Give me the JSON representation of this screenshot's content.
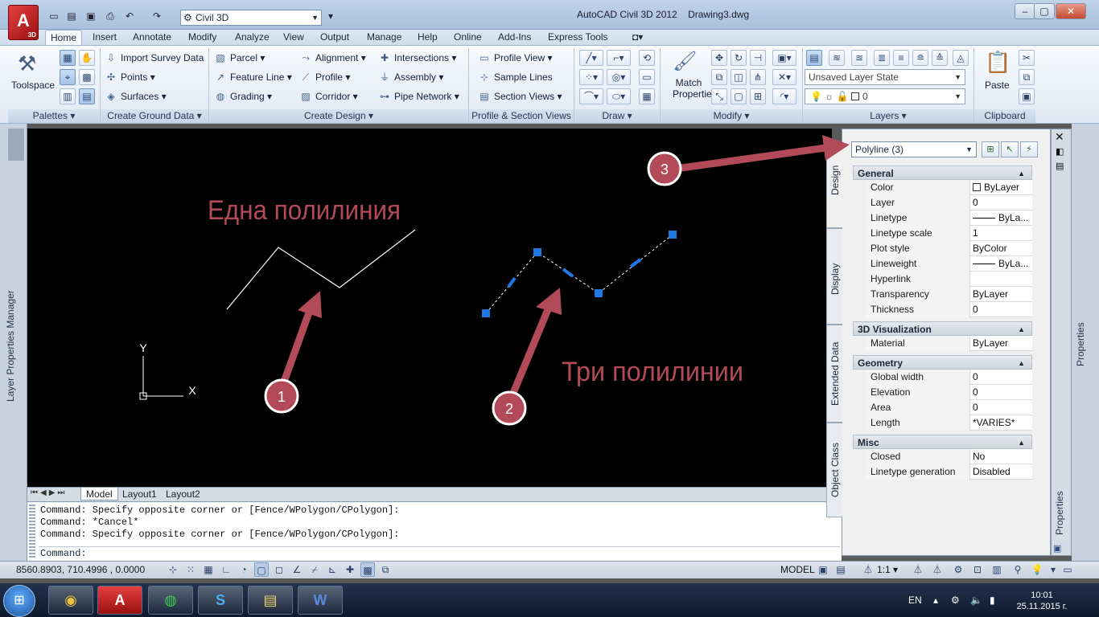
{
  "window": {
    "title": "AutoCAD Civil 3D 2012",
    "document": "Drawing3.dwg",
    "workspace": "Civil 3D",
    "logo_sub": "3D"
  },
  "tabs": [
    "Home",
    "Insert",
    "Annotate",
    "Modify",
    "Analyze",
    "View",
    "Output",
    "Manage",
    "Help",
    "Online",
    "Add-Ins",
    "Express Tools"
  ],
  "ribbon": {
    "toolspace": "Toolspace",
    "ground": {
      "import": "Import Survey Data",
      "points": "Points",
      "surfaces": "Surfaces"
    },
    "design": {
      "parcel": "Parcel",
      "feature_line": "Feature Line",
      "grading": "Grading",
      "alignment": "Alignment",
      "profile": "Profile",
      "corridor": "Corridor",
      "intersections": "Intersections",
      "assembly": "Assembly",
      "pipe_network": "Pipe Network"
    },
    "profile": {
      "profile_view": "Profile View",
      "sample_lines": "Sample Lines",
      "section_views": "Section Views"
    },
    "match_properties": "Match Properties",
    "layer_state": "Unsaved Layer State",
    "layer_name": "0",
    "paste": "Paste",
    "panels": {
      "palettes": "Palettes",
      "ground": "Create Ground Data",
      "design": "Create Design",
      "profile": "Profile & Section Views",
      "draw": "Draw",
      "modify": "Modify",
      "layers": "Layers",
      "clipboard": "Clipboard"
    }
  },
  "left_palette": "Layer Properties Manager",
  "canvas": {
    "label_one": "Една полилиния",
    "label_three": "Три полилинии",
    "callouts": [
      "1",
      "2",
      "3"
    ],
    "ucs_y": "Y",
    "ucs_x": "X"
  },
  "layout_tabs": [
    "Model",
    "Layout1",
    "Layout2"
  ],
  "command": {
    "history": [
      "Command: Specify opposite corner or [Fence/WPolygon/CPolygon]:",
      "Command: *Cancel*",
      "Command: Specify opposite corner or [Fence/WPolygon/CPolygon]:"
    ],
    "prompt": "Command:"
  },
  "properties": {
    "selection": "Polyline (3)",
    "vertical_tabs": [
      "Design",
      "Display",
      "Extended Data",
      "Object Class"
    ],
    "palette_label": "Properties",
    "categories": [
      {
        "name": "General",
        "rows": [
          {
            "name": "Color",
            "value": "ByLayer"
          },
          {
            "name": "Layer",
            "value": "0"
          },
          {
            "name": "Linetype",
            "value": "ByLa..."
          },
          {
            "name": "Linetype scale",
            "value": "1"
          },
          {
            "name": "Plot style",
            "value": "ByColor"
          },
          {
            "name": "Lineweight",
            "value": "ByLa..."
          },
          {
            "name": "Hyperlink",
            "value": ""
          },
          {
            "name": "Transparency",
            "value": "ByLayer"
          },
          {
            "name": "Thickness",
            "value": "0"
          }
        ]
      },
      {
        "name": "3D Visualization",
        "rows": [
          {
            "name": "Material",
            "value": "ByLayer"
          }
        ]
      },
      {
        "name": "Geometry",
        "rows": [
          {
            "name": "Global width",
            "value": "0"
          },
          {
            "name": "Elevation",
            "value": "0"
          },
          {
            "name": "Area",
            "value": "0"
          },
          {
            "name": "Length",
            "value": "*VARIES*"
          }
        ]
      },
      {
        "name": "Misc",
        "rows": [
          {
            "name": "Closed",
            "value": "No"
          },
          {
            "name": "Linetype generation",
            "value": "Disabled"
          }
        ]
      }
    ]
  },
  "status": {
    "coords": "8560.8903, 710.4996 , 0.0000",
    "model": "MODEL",
    "scale": "1:1"
  },
  "taskbar": {
    "lang": "EN",
    "time": "10:01",
    "date": "25.11.2015 г."
  },
  "colors": {
    "callout": "#b34a57",
    "grip": "#1e78e6",
    "canvas": "#000000"
  }
}
